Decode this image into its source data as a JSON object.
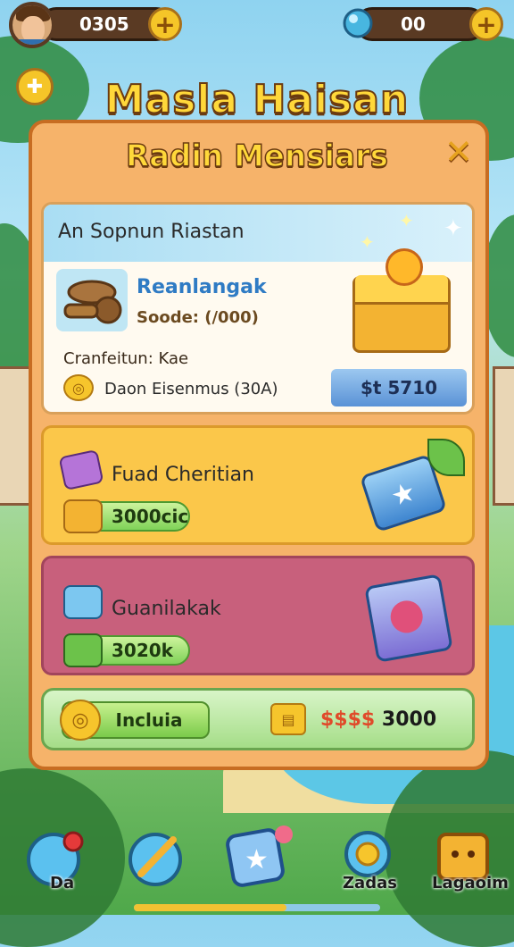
{
  "hud": {
    "coins": "0305",
    "gems": "00"
  },
  "titles": {
    "main": "Masla Haisan",
    "sub": "Radin Mensiars"
  },
  "offer": {
    "header": "An Sopnun Riastan",
    "item_name": "Reanlangak",
    "item_price": "Soode: (/000)",
    "confirm_label": "Cranfeitun: Kae",
    "bonus_text": "Daon Eisenmus (30A)",
    "buy_label": "$t 5710"
  },
  "cards": [
    {
      "name": "Fuad Cheritian",
      "value": "3000cic"
    },
    {
      "name": "Guanilakak",
      "value": "3020k"
    }
  ],
  "bottom_bar": {
    "menu_label": "Incluia",
    "total_prefix": "$$$$",
    "total_value": "3000"
  },
  "nav": {
    "items": [
      {
        "label": "Da",
        "icon": "orb-icon"
      },
      {
        "label": "",
        "icon": "sword-icon"
      },
      {
        "label": "",
        "icon": "star-card-icon"
      },
      {
        "label": "Zadas",
        "icon": "coin-icon"
      },
      {
        "label": "Lagaoim",
        "icon": "dice-icon"
      }
    ],
    "progress": 0.62
  },
  "colors": {
    "panel": "#f6b36a",
    "title": "#ffd83a",
    "card_yellow": "#fbc74a",
    "card_pink": "#c8607c",
    "accent_blue": "#5a92d6"
  }
}
